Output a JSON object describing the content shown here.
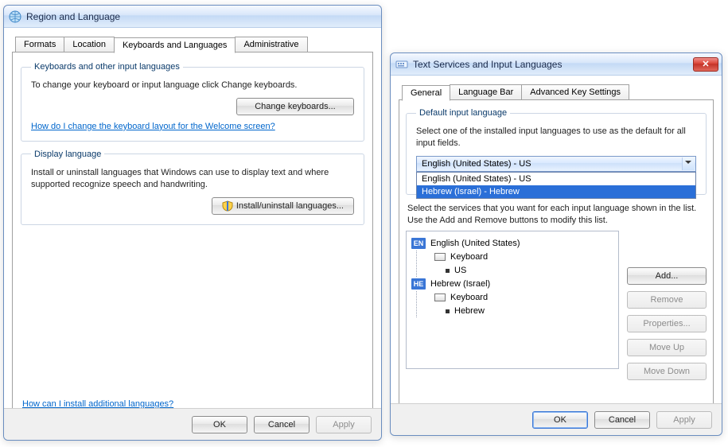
{
  "left": {
    "title": "Region and Language",
    "tabs": [
      "Formats",
      "Location",
      "Keyboards and Languages",
      "Administrative"
    ],
    "active_tab": "Keyboards and Languages",
    "group1_legend": "Keyboards and other input languages",
    "group1_text": "To change your keyboard or input language click Change keyboards.",
    "btn_change_keyboards": "Change keyboards...",
    "help_welcome": "How do I change the keyboard layout for the Welcome screen?",
    "group2_legend": "Display language",
    "group2_text": "Install or uninstall languages that Windows can use to display text and where supported recognize speech and handwriting.",
    "btn_install": "Install/uninstall languages...",
    "help_additional": "How can I install additional languages?",
    "ok": "OK",
    "cancel": "Cancel",
    "apply": "Apply"
  },
  "right": {
    "title": "Text Services and Input Languages",
    "tabs": [
      "General",
      "Language Bar",
      "Advanced Key Settings"
    ],
    "active_tab": "General",
    "group1_legend": "Default input language",
    "group1_text": "Select one of the installed input languages to use as the default for all input fields.",
    "combo_value": "English (United States) - US",
    "dropdown_opts": [
      "English (United States) - US",
      "Hebrew (Israel) - Hebrew"
    ],
    "dropdown_selected_idx": 1,
    "group2_text": "Select the services that you want for each input language shown in the list. Use the Add and Remove buttons to modify this list.",
    "tree": {
      "en_label": "English (United States)",
      "kbd_label": "Keyboard",
      "us_label": "US",
      "he_label": "Hebrew (Israel)",
      "heb_label": "Hebrew",
      "en_badge": "EN",
      "he_badge": "HE"
    },
    "btn_add": "Add...",
    "btn_remove": "Remove",
    "btn_properties": "Properties...",
    "btn_moveup": "Move Up",
    "btn_movedown": "Move Down",
    "ok": "OK",
    "cancel": "Cancel",
    "apply": "Apply"
  }
}
